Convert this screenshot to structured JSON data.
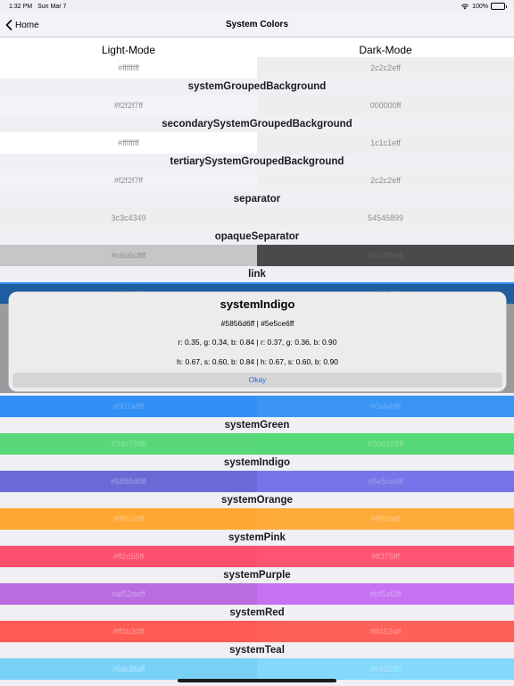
{
  "status": {
    "time": "1:32 PM",
    "date": "Sun Mar 7",
    "battery": "100%"
  },
  "nav": {
    "back_label": "Home",
    "title": "System Colors"
  },
  "header": {
    "light": "Light-Mode",
    "dark": "Dark-Mode"
  },
  "first_row": {
    "light_hex": "#ffffffff",
    "dark_hex": "2c2c2eff",
    "light_bg": "#ffffff",
    "dark_bg": "#eeeeee",
    "light_text": "#8e8e93",
    "dark_text": "#8e8e93"
  },
  "sections_top": [
    {
      "name": "systemGroupedBackground",
      "light_hex": "#f2f2f7ff",
      "dark_hex": "000000ff",
      "light_bg": "#f2f2f7",
      "dark_bg": "#eeeeee",
      "light_text": "#8e8e93",
      "dark_text": "#8e8e93"
    },
    {
      "name": "secondarySystemGroupedBackground",
      "light_hex": "#ffffffff",
      "dark_hex": "1c1c1eff",
      "light_bg": "#ffffff",
      "dark_bg": "#eeeeee",
      "light_text": "#8e8e93",
      "dark_text": "#8e8e93"
    },
    {
      "name": "tertiarySystemGroupedBackground",
      "light_hex": "#f2f2f7ff",
      "dark_hex": "2c2c2eff",
      "light_bg": "#f2f2f7",
      "dark_bg": "#eeeeee",
      "light_text": "#8e8e93",
      "dark_text": "#8e8e93"
    },
    {
      "name": "separator",
      "light_hex": "3c3c4349",
      "dark_hex": "54545899",
      "light_bg": "#eeeeee",
      "dark_bg": "#eeeeee",
      "light_text": "#8e8e93",
      "dark_text": "#8e8e93"
    },
    {
      "name": "opaqueSeparator",
      "light_hex": "#c6c6c8ff",
      "dark_hex": "#38383aff",
      "light_bg": "#c6c6c8",
      "dark_bg": "#4a4a4c",
      "light_text": "#8e8e93",
      "dark_text": "#5e5e62"
    },
    {
      "name": "link",
      "light_hex": "#007affff",
      "dark_hex": "#0984ffff",
      "light_bg": "#2f8ff5",
      "dark_bg": "#2f8ff5",
      "light_text": "#6aaef8",
      "dark_text": "#6aaef8"
    }
  ],
  "blue_row": {
    "light_hex": "#007affff",
    "dark_hex": "#0a84ffff",
    "light_bg": "#2f8ff5",
    "dark_bg": "#3a95f5",
    "light_text": "#6aaef8",
    "dark_text": "#6aaef8"
  },
  "sections_bottom": [
    {
      "name": "systemGreen",
      "light_hex": "#34c759ff",
      "dark_hex": "#30d158ff",
      "light_bg": "#58d878",
      "dark_bg": "#55d876",
      "light_text": "#8ae6a0",
      "dark_text": "#8ae6a0"
    },
    {
      "name": "systemIndigo",
      "light_hex": "#5856d6ff",
      "dark_hex": "#5e5ce6ff",
      "light_bg": "#6b69d6",
      "dark_bg": "#7674e8",
      "light_text": "#a2a1e6",
      "dark_text": "#a2a1e6"
    },
    {
      "name": "systemOrange",
      "light_hex": "#ff9500ff",
      "dark_hex": "#ff9f0aff",
      "light_bg": "#ffa733",
      "dark_bg": "#ffab3b",
      "light_text": "#ffc97f",
      "dark_text": "#ffc97f"
    },
    {
      "name": "systemPink",
      "light_hex": "#ff2d55ff",
      "dark_hex": "#ff375fff",
      "light_bg": "#ff4f6e",
      "dark_bg": "#ff5573",
      "light_text": "#ff97a9",
      "dark_text": "#ff97a9"
    },
    {
      "name": "systemPurple",
      "light_hex": "#af52deff",
      "dark_hex": "#bf5af2ff",
      "light_bg": "#b96be0",
      "dark_bg": "#c772f2",
      "light_text": "#d7a5ee",
      "dark_text": "#d7a5ee"
    },
    {
      "name": "systemRed",
      "light_hex": "#ff3b30ff",
      "dark_hex": "#ff453aff",
      "light_bg": "#ff5b52",
      "dark_bg": "#ff6057",
      "light_text": "#ff9e98",
      "dark_text": "#ff9e98"
    },
    {
      "name": "systemTeal",
      "light_hex": "#5ac8faff",
      "dark_hex": "#64d2ffff",
      "light_bg": "#7ad1f8",
      "dark_bg": "#83d8fb",
      "light_text": "#b3e5fb",
      "dark_text": "#b3e5fb"
    }
  ],
  "alert": {
    "title": "systemIndigo",
    "hex_line": "#5856d6ff | #5e5ce6ff",
    "rgb_line": "r: 0.35, g: 0.34, b: 0.84 | r: 0.37, g: 0.36, b: 0.90",
    "hsb_line": "h: 0.67, s: 0.60, b: 0.84 | h: 0.67, s: 0.60, b: 0.90",
    "button_label": "Okay"
  }
}
